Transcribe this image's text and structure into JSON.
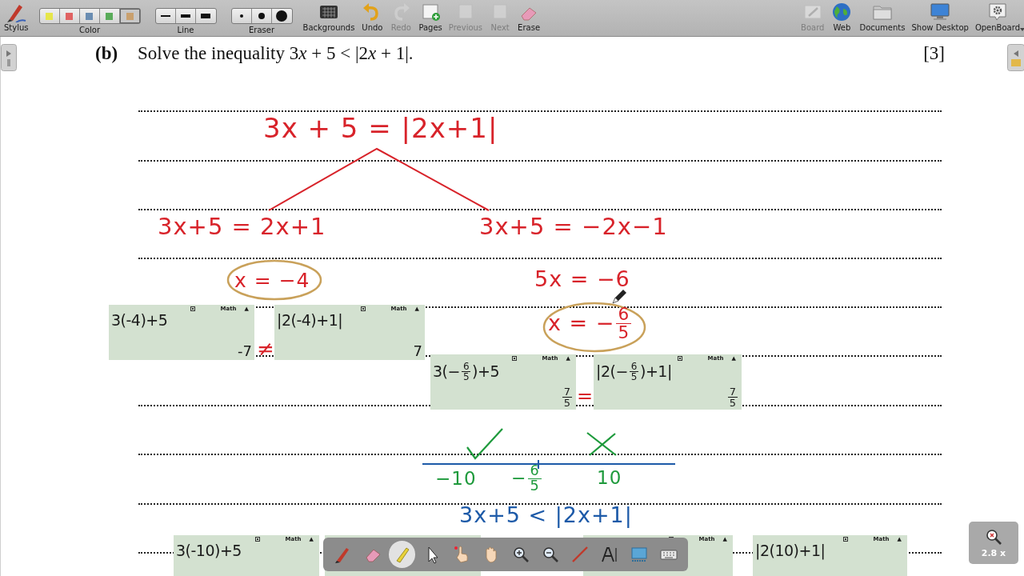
{
  "toolbar": {
    "left": [
      {
        "kind": "stylus",
        "label": "Stylus",
        "disabled": false
      },
      {
        "kind": "colors",
        "label": "Color",
        "options": [
          {
            "color": "#e6e64a",
            "selected": false
          },
          {
            "color": "#e06262",
            "selected": false
          },
          {
            "color": "#6a8db2",
            "selected": false
          },
          {
            "color": "#5aac5a",
            "selected": false
          },
          {
            "color": "#c9a06e",
            "selected": true
          }
        ]
      },
      {
        "kind": "lines",
        "label": "Line",
        "options": [
          {
            "kind": "small"
          },
          {
            "kind": "medium"
          },
          {
            "kind": "large"
          }
        ]
      },
      {
        "kind": "erasers",
        "label": "Eraser",
        "options": [
          {
            "kind": "small"
          },
          {
            "kind": "medium"
          },
          {
            "kind": "large"
          }
        ]
      },
      {
        "kind": "backgrounds",
        "label": "Backgrounds",
        "disabled": false
      },
      {
        "kind": "undo",
        "label": "Undo",
        "disabled": false
      },
      {
        "kind": "redo",
        "label": "Redo",
        "disabled": true
      },
      {
        "kind": "pages",
        "label": "Pages",
        "disabled": false
      },
      {
        "kind": "previous",
        "label": "Previous",
        "disabled": true
      },
      {
        "kind": "next",
        "label": "Next",
        "disabled": true
      },
      {
        "kind": "erase",
        "label": "Erase",
        "disabled": false
      }
    ],
    "right": [
      {
        "kind": "board",
        "label": "Board",
        "disabled": true
      },
      {
        "kind": "web",
        "label": "Web",
        "disabled": false
      },
      {
        "kind": "documents",
        "label": "Documents",
        "disabled": false
      },
      {
        "kind": "desktop",
        "label": "Show Desktop",
        "disabled": false
      },
      {
        "kind": "openboard",
        "label": "OpenBoard",
        "disabled": false
      }
    ]
  },
  "question": {
    "label": "(b)",
    "parts": [
      {
        "text": "Solve the inequality 3",
        "italic": false
      },
      {
        "text": "x",
        "italic": true
      },
      {
        "text": " + 5 < |2",
        "italic": false
      },
      {
        "text": "x",
        "italic": true
      },
      {
        "text": " + 1|.",
        "italic": false
      }
    ],
    "marks": "[3]"
  },
  "handwriting": [
    {
      "parts": [
        {
          "text": "3x + 5 = |2x+1|"
        }
      ],
      "color": "#d8232a"
    },
    {
      "parts": [
        {
          "text": "3x+5 = 2x+1"
        }
      ],
      "color": "#d8232a"
    },
    {
      "parts": [
        {
          "text": "3x+5 = −2x−1"
        }
      ],
      "color": "#d8232a"
    },
    {
      "parts": [
        {
          "text": "x = −4"
        }
      ],
      "color": "#d8232a"
    },
    {
      "parts": [
        {
          "text": "5x = −6"
        }
      ],
      "color": "#d8232a"
    },
    {
      "parts": [
        {
          "text": "x = −"
        },
        {
          "num": "6",
          "den": "5"
        }
      ],
      "color": "#d8232a"
    },
    {
      "parts": [
        {
          "text": "≠"
        }
      ],
      "color": "#d8232a"
    },
    {
      "parts": [
        {
          "text": "="
        }
      ],
      "color": "#d8232a"
    },
    {
      "parts": [
        {
          "text": "−10"
        }
      ],
      "color": "#1e9a3c"
    },
    {
      "parts": [
        {
          "text": "−"
        },
        {
          "num": "6",
          "den": "5"
        }
      ],
      "color": "#1e9a3c"
    },
    {
      "parts": [
        {
          "text": "10"
        }
      ],
      "color": "#1e9a3c"
    },
    {
      "parts": [
        {
          "text": "3x+5 < |2x+1|"
        }
      ],
      "color": "#1d5aa8"
    }
  ],
  "calculator_screens": [
    {
      "mode": "Math",
      "indicator": "▲",
      "expression": [
        {
          "text": "3(-4)+5"
        }
      ],
      "result": [
        {
          "text": "-7"
        }
      ]
    },
    {
      "mode": "Math",
      "indicator": "▲",
      "expression": [
        {
          "text": "|2(-4)+1|"
        }
      ],
      "result": [
        {
          "text": "7"
        }
      ]
    },
    {
      "mode": "Math",
      "indicator": "▲",
      "expression": [
        {
          "text": "3(−"
        },
        {
          "num": "6",
          "den": "5"
        },
        {
          "text": ")+5"
        }
      ],
      "result": [
        {
          "num": "7",
          "den": "5"
        }
      ]
    },
    {
      "mode": "Math",
      "indicator": "▲",
      "expression": [
        {
          "text": "|2(−"
        },
        {
          "num": "6",
          "den": "5"
        },
        {
          "text": ")+1|"
        }
      ],
      "result": [
        {
          "num": "7",
          "den": "5"
        }
      ]
    },
    {
      "mode": "Math",
      "indicator": "▲",
      "expression": [
        {
          "text": "3(-10)+5"
        }
      ]
    },
    {
      "mode": "Math",
      "indicator": "▲"
    },
    {
      "mode": "Math",
      "indicator": "▲",
      "expression": [
        {
          "text": "|2(10)+1|"
        }
      ]
    }
  ],
  "floating_toolbar": {
    "tools": [
      {
        "kind": "pen",
        "selected": false
      },
      {
        "kind": "eraser",
        "selected": false
      },
      {
        "kind": "highlighter",
        "selected": true
      },
      {
        "kind": "pointer",
        "selected": false
      },
      {
        "kind": "laser",
        "selected": false
      },
      {
        "kind": "hand",
        "selected": false
      },
      {
        "kind": "zoomin",
        "selected": false
      },
      {
        "kind": "zoomout",
        "selected": false
      },
      {
        "kind": "line",
        "selected": false
      },
      {
        "kind": "text",
        "selected": false
      },
      {
        "kind": "capture",
        "selected": false
      },
      {
        "kind": "keyboard",
        "selected": false
      }
    ]
  },
  "zoom_indicator": {
    "label": "2.8 x"
  }
}
